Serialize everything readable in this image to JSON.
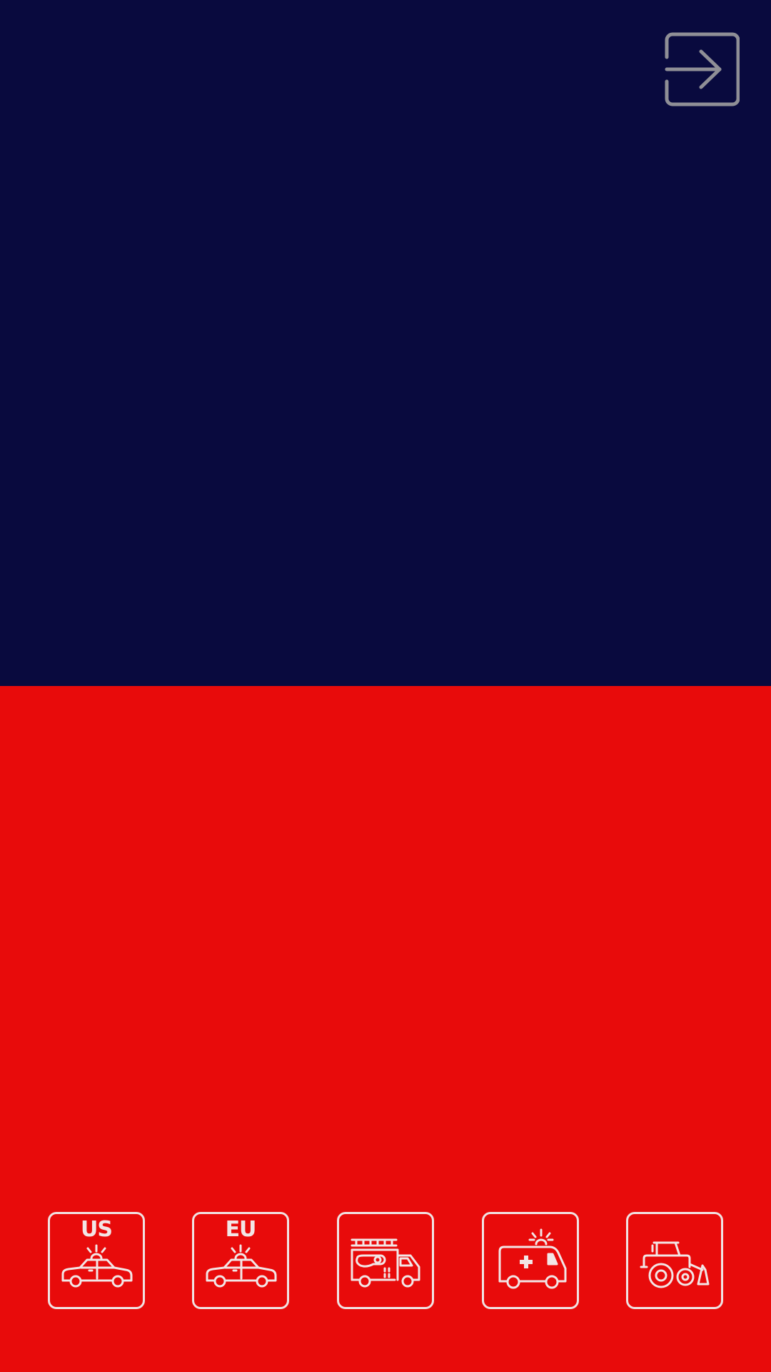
{
  "colors": {
    "top_panel": "#090a3e",
    "bottom_panel": "#e80b0b",
    "icon_stroke": "#f2e6e6",
    "exit_icon": "#8f8f96"
  },
  "header": {
    "exit_icon": "exit-arrow-icon"
  },
  "vehicles": [
    {
      "label": "US",
      "icon": "police-car-icon"
    },
    {
      "label": "EU",
      "icon": "police-car-icon"
    },
    {
      "label": "",
      "icon": "fire-truck-icon"
    },
    {
      "label": "",
      "icon": "ambulance-icon"
    },
    {
      "label": "",
      "icon": "bulldozer-icon"
    }
  ]
}
